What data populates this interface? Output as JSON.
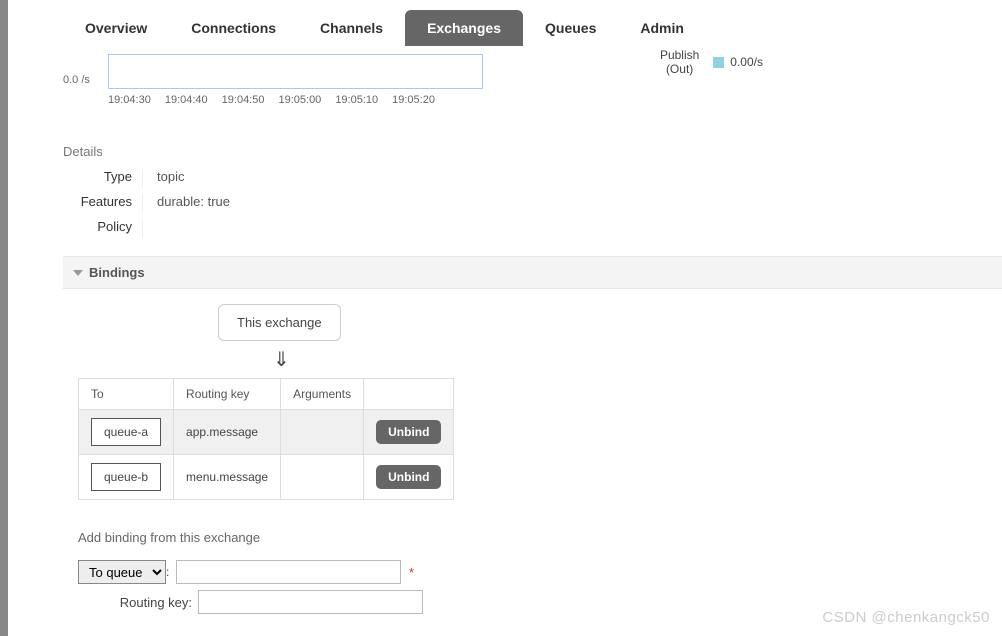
{
  "tabs": {
    "overview": "Overview",
    "connections": "Connections",
    "channels": "Channels",
    "exchanges": "Exchanges",
    "queues": "Queues",
    "admin": "Admin"
  },
  "chart_data": {
    "type": "line",
    "yaxis_rate": "0.0 /s",
    "ticks": [
      "19:04:30",
      "19:04:40",
      "19:04:50",
      "19:05:00",
      "19:05:10",
      "19:05:20"
    ],
    "legend_label_top": "Publish",
    "legend_label_bottom": "(Out)",
    "legend_rate": "0.00/s",
    "series": [
      {
        "name": "Publish (Out)",
        "values": [
          0,
          0,
          0,
          0,
          0,
          0
        ]
      }
    ],
    "xlabel": "",
    "ylabel": "",
    "ylim": [
      0,
      1
    ]
  },
  "details": {
    "title": "Details",
    "labels": {
      "type": "Type",
      "features": "Features",
      "policy": "Policy"
    },
    "type_val": "topic",
    "features_key": "durable:",
    "features_val": "true"
  },
  "bindings": {
    "section_title": "Bindings",
    "this_exchange": "This exchange",
    "arrow": "⇓",
    "headers": {
      "to": "To",
      "routing_key": "Routing key",
      "arguments": "Arguments"
    },
    "rows": [
      {
        "to": "queue-a",
        "routing_key": "app.message",
        "arguments": "",
        "action": "Unbind"
      },
      {
        "to": "queue-b",
        "routing_key": "menu.message",
        "arguments": "",
        "action": "Unbind"
      }
    ]
  },
  "addbinding": {
    "title": "Add binding from this exchange",
    "dest_option": "To queue",
    "colon": ":",
    "routing_key_label": "Routing key:",
    "required": "*"
  },
  "watermark": "CSDN @chenkangck50"
}
